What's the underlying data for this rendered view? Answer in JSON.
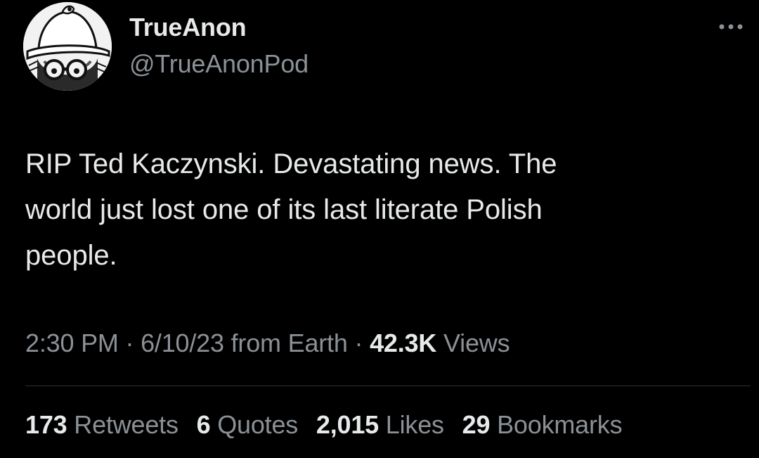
{
  "author": {
    "display_name": "TrueAnon",
    "handle": "@TrueAnonPod",
    "avatar_icon": "hat-and-glasses-avatar-icon"
  },
  "menu": {
    "more_icon": "more-horizontal-icon"
  },
  "tweet": {
    "text": "RIP Ted Kaczynski. Devastating news. The\nworld just lost one of its last literate Polish\npeople."
  },
  "meta": {
    "time": "2:30 PM",
    "separator": "·",
    "date": "6/10/23",
    "source": "from Earth",
    "views_count": "42.3K",
    "views_label": "Views"
  },
  "stats": {
    "retweets": {
      "count": "173",
      "label": "Retweets"
    },
    "quotes": {
      "count": "6",
      "label": "Quotes"
    },
    "likes": {
      "count": "2,015",
      "label": "Likes"
    },
    "bookmarks": {
      "count": "29",
      "label": "Bookmarks"
    }
  },
  "colors": {
    "background": "#000000",
    "primary_text": "#e7e9ea",
    "secondary_text": "#8b9196",
    "divider": "#2f3336"
  }
}
